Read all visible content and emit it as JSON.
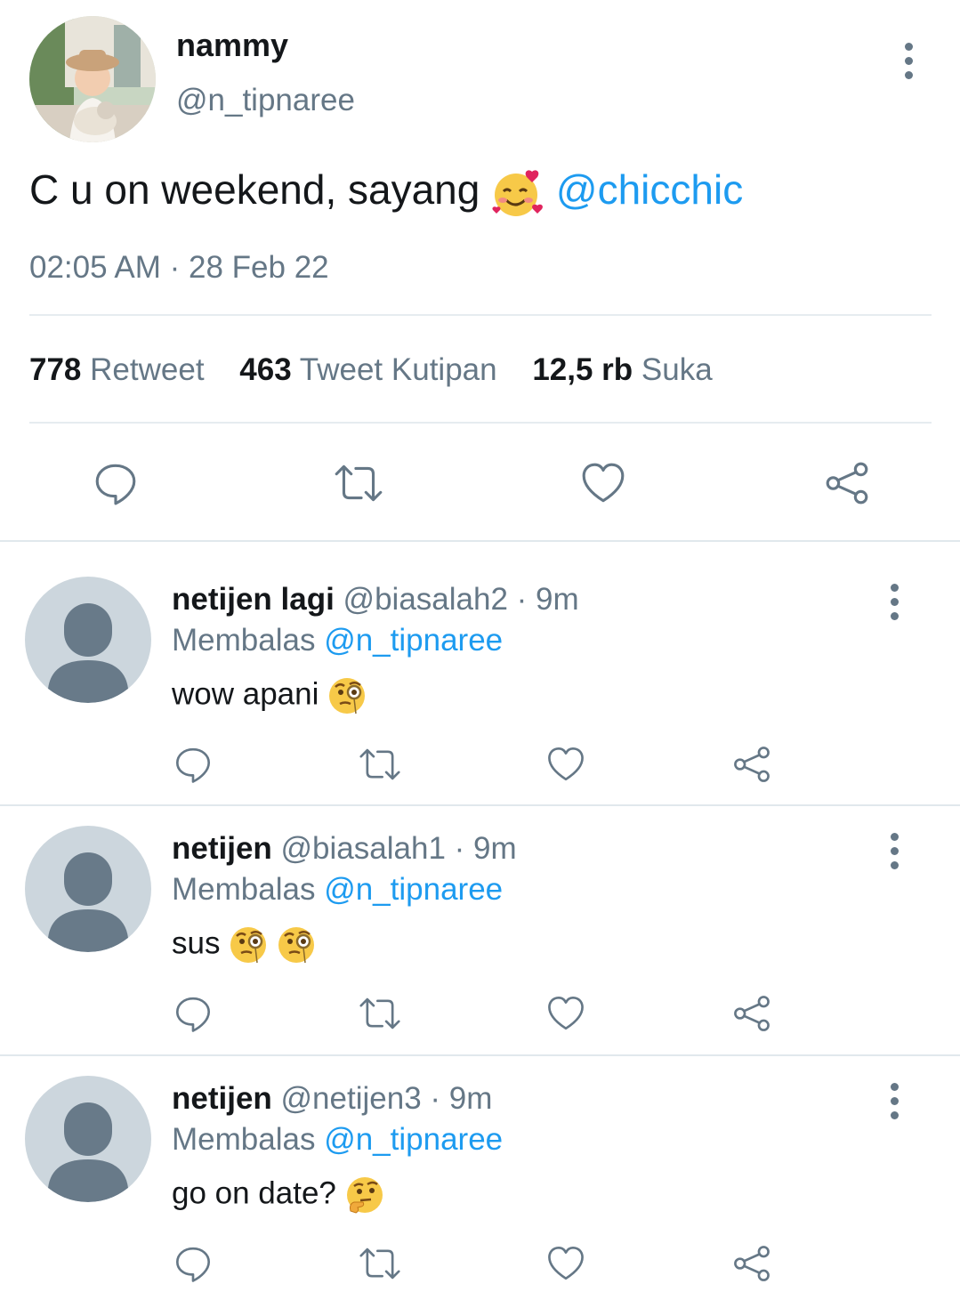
{
  "tweet": {
    "author_name": "nammy",
    "author_handle": "@n_tipnaree",
    "text": "C u on weekend, sayang",
    "text_emoji": "smiling-face-with-hearts",
    "mention": "@chicchic",
    "time": "02:05 AM",
    "separator": "·",
    "date": "28 Feb 22",
    "stats": {
      "retweets_count": "778",
      "retweets_label": "Retweet",
      "quotes_count": "463",
      "quotes_label": "Tweet Kutipan",
      "likes_count": "12,5 rb",
      "likes_label": "Suka"
    },
    "actions": [
      "reply-icon",
      "retweet-icon",
      "like-icon",
      "share-icon"
    ]
  },
  "replies": [
    {
      "name": "netijen lagi",
      "handle": "@biasalah2",
      "age": "9m",
      "replying_label": "Membalas",
      "replying_to": "@n_tipnaree",
      "text": "wow apani",
      "emojis": [
        "face-with-monocle"
      ]
    },
    {
      "name": "netijen",
      "handle": "@biasalah1",
      "age": "9m",
      "replying_label": "Membalas",
      "replying_to": "@n_tipnaree",
      "text": "sus",
      "emojis": [
        "face-with-monocle",
        "face-with-monocle"
      ]
    },
    {
      "name": "netijen",
      "handle": "@netijen3",
      "age": "9m",
      "replying_label": "Membalas",
      "replying_to": "@n_tipnaree",
      "text": "go on date?",
      "emojis": [
        "thinking-face"
      ]
    }
  ],
  "colors": {
    "link": "#1d9bf0",
    "muted": "#657786",
    "divider": "#e1e8ed",
    "default_avatar_bg": "#ccd6dd",
    "default_avatar_fg": "#687a89"
  }
}
